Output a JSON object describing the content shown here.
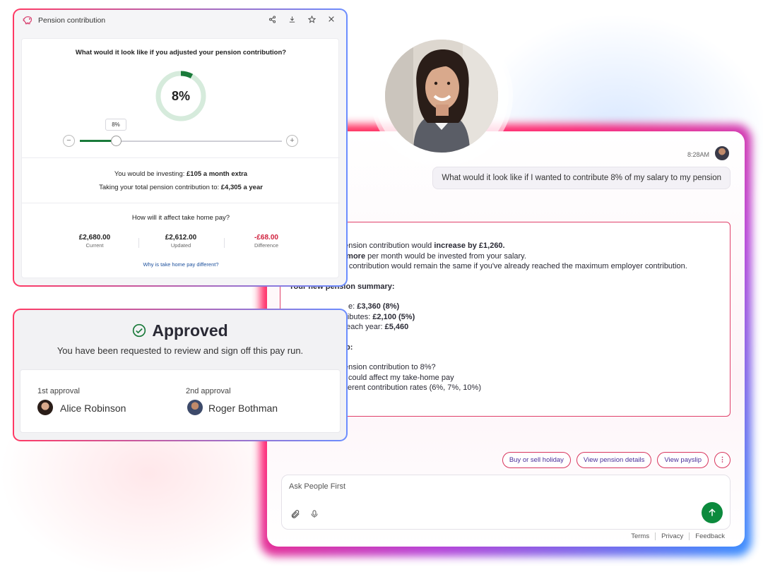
{
  "pension_card": {
    "title": "Pension contribution",
    "question": "What would it look like if you adjusted your pension contribution?",
    "percent_display": "8%",
    "percent_value": 8,
    "slider_tooltip": "8%",
    "minus_label": "−",
    "plus_label": "+",
    "investing_prefix": "You would be investing: ",
    "investing_value": "£105 a month extra",
    "total_prefix": "Taking your total pension contribution to: ",
    "total_value": "£4,305 a year",
    "take_home_question": "How will it affect take home pay?",
    "amounts": [
      {
        "value": "£2,680.00",
        "label": "Current"
      },
      {
        "value": "£2,612.00",
        "label": "Updated"
      },
      {
        "value": "-£68.00",
        "label": "Difference"
      }
    ],
    "link": "Why is take home pay different?",
    "colors": {
      "progress": "#1a7a3a",
      "negative": "#d0213e"
    }
  },
  "approved_card": {
    "title": "Approved",
    "subtitle": "You have been requested to review and sign off this pay run.",
    "approvals": [
      {
        "label": "1st approval",
        "name": "Alice Robinson"
      },
      {
        "label": "2nd approval",
        "name": "Roger Bothman"
      }
    ]
  },
  "chat": {
    "time": "8:28AM",
    "user_message": "What would it look like if I wanted to contribute 8% of my salary to my pension",
    "reply": {
      "l1a": "pension contribution would ",
      "l1b": "increase by £1,260.",
      "l2a": "5 more",
      "l2b": " per month would be invested from your salary.",
      "l3": "er contribution would remain the same if you've already reached the maximum employer contribution.",
      "summary_title": "Your new pension summary:",
      "s1a": "e: ",
      "s1b": "£3,360 (8%)",
      "s2a": "ntributes: ",
      "s2b": "£2,100 (5%)",
      "s3a": "d each year: ",
      "s3b": "£5,460",
      "p": "p:",
      "q1": "ension contribution to 8%?",
      "q2": "could affect my take-home pay",
      "q3": "ferent contribution rates (6%, 7%, 10%)"
    },
    "chips": [
      "Buy or sell holiday",
      "View pension details",
      "View payslip"
    ],
    "more_label": "⋮",
    "composer_placeholder": "Ask People First",
    "footer": [
      "Terms",
      "Privacy",
      "Feedback"
    ]
  },
  "icons": [
    "piggy-bank-icon",
    "share-icon",
    "download-icon",
    "star-icon",
    "close-icon",
    "check-circle-icon",
    "paperclip-icon",
    "microphone-icon",
    "send-arrow-icon"
  ]
}
